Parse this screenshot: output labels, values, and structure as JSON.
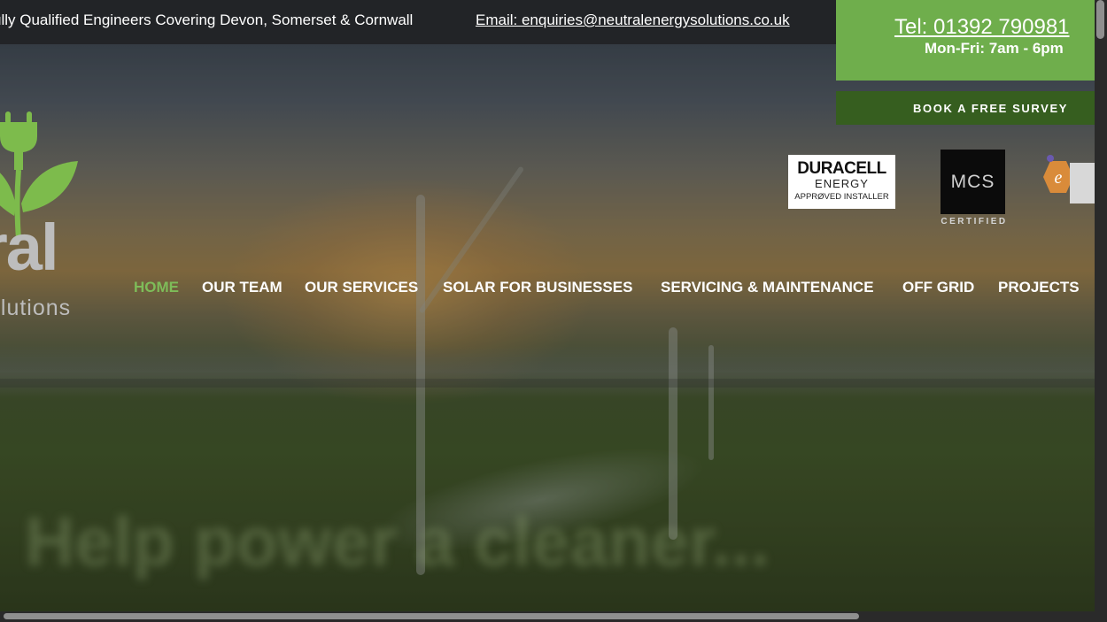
{
  "topbar": {
    "tagline": "ully Qualified Engineers Covering Devon, Somerset & Cornwall",
    "email": "Email: enquiries@neutralenergysolutions.co.uk"
  },
  "contact": {
    "phone": "Tel:  01392 790981",
    "hours": "Mon-Fri: 7am - 6pm",
    "survey_button": "BOOK A FREE SURVEY"
  },
  "logo": {
    "word": "ral",
    "sub": "olutions",
    "icon": "plug-leaf-icon"
  },
  "badges": {
    "duracell": {
      "line1": "DURACELL",
      "line2": "ENERGY",
      "line3": "APPRØVED INSTALLER"
    },
    "mcs": {
      "mark": "MCS",
      "sub": "CERTIFIED"
    },
    "reco": "recc-badge-icon"
  },
  "nav": {
    "items": [
      {
        "label": "HOME",
        "active": true
      },
      {
        "label": "OUR TEAM"
      },
      {
        "label": "OUR SERVICES"
      },
      {
        "label": "SOLAR FOR BUSINESSES"
      },
      {
        "label": "SERVICING & MAINTENANCE"
      },
      {
        "label": "OFF GRID"
      },
      {
        "label": "PROJECTS"
      }
    ]
  },
  "hero": {
    "subtitle": "",
    "title": "Help power a cleaner..."
  },
  "colors": {
    "brand_green": "#6fae4c",
    "dark_green": "#365e1f",
    "active_nav": "#7ebc59",
    "topbar": "#222427"
  }
}
